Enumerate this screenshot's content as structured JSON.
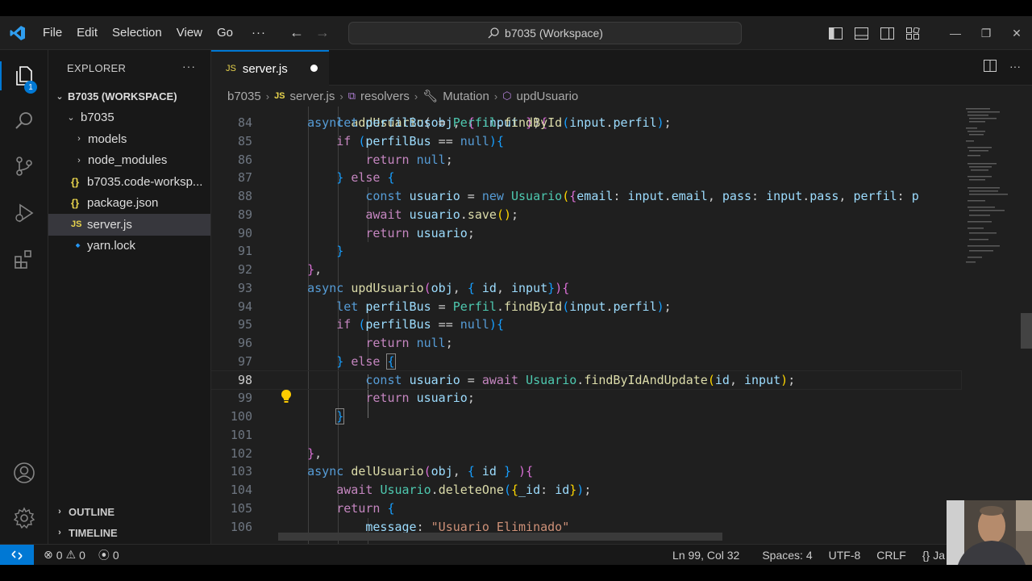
{
  "menu": {
    "file": "File",
    "edit": "Edit",
    "selection": "Selection",
    "view": "View",
    "go": "Go",
    "more": "···"
  },
  "command_center": {
    "label": "b7035 (Workspace)"
  },
  "activity": {
    "explorer_badge": "1"
  },
  "sidebar": {
    "title": "EXPLORER",
    "more": "···",
    "workspace": "B7035 (WORKSPACE)",
    "folder": "b7035",
    "items": [
      {
        "label": "models",
        "kind": "folder"
      },
      {
        "label": "node_modules",
        "kind": "folder"
      },
      {
        "label": "b7035.code-worksp...",
        "kind": "json",
        "icon": "{}"
      },
      {
        "label": "package.json",
        "kind": "json",
        "icon": "{}"
      },
      {
        "label": "server.js",
        "kind": "js",
        "icon": "JS"
      },
      {
        "label": "yarn.lock",
        "kind": "yarn",
        "icon": "🔹"
      }
    ],
    "outline": "OUTLINE",
    "timeline": "TIMELINE"
  },
  "tab": {
    "icon": "JS",
    "label": "server.js"
  },
  "breadcrumb": {
    "folder": "b7035",
    "file_icon": "JS",
    "file": "server.js",
    "resolvers": "resolvers",
    "mutation": "Mutation",
    "fn": "updUsuario"
  },
  "editor": {
    "line_numbers": [
      "84",
      "85",
      "86",
      "87",
      "88",
      "89",
      "90",
      "91",
      "92",
      "93",
      "94",
      "95",
      "96",
      "97",
      "98",
      "99",
      "100",
      "101",
      "102",
      "103",
      "104",
      "105",
      "106"
    ],
    "current_line": "98"
  },
  "status": {
    "errors": "0",
    "warnings": "0",
    "ports": "0",
    "position": "Ln 99, Col 32",
    "spaces": "Spaces: 4",
    "encoding": "UTF-8",
    "eol": "CRLF",
    "language": "Ja"
  },
  "colors": {
    "accent": "#0078d4",
    "keyword": "#569cd6",
    "control": "#c586c0",
    "function": "#dcdcaa",
    "variable": "#9cdcfe",
    "class": "#4ec9b0",
    "string": "#ce9178"
  }
}
